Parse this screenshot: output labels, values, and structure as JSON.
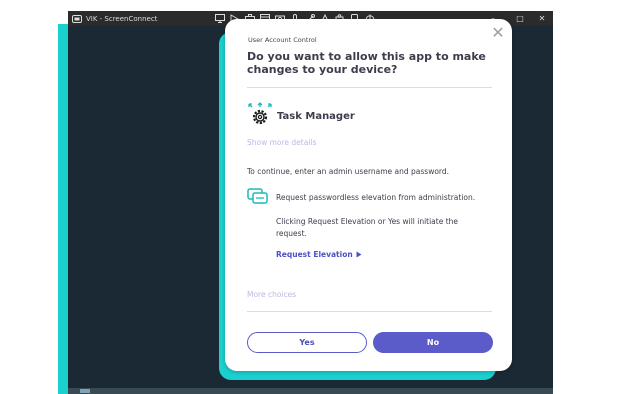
{
  "window": {
    "title": "VIK - ScreenConnect",
    "toolbar_icons": [
      "monitor-icon",
      "pointer-icon",
      "briefcase-icon",
      "grid-icon",
      "camera-icon",
      "mic-icon",
      "tools-icon",
      "flag-icon",
      "puzzle-icon",
      "phone-icon",
      "power-icon"
    ],
    "minimize": "–",
    "maximize": "□",
    "close": "✕"
  },
  "dialog": {
    "header_label": "User Account Control",
    "question": "Do you want to allow this app to make changes to your device?",
    "close_glyph": "✕",
    "app_name": "Task Manager",
    "show_more_details": "Show more details",
    "continue_text": "To continue, enter an admin username and password.",
    "elevation_text": "Request passwordless elevation from administration.",
    "clicking_text": "Clicking Request Elevation or Yes will initiate the request.",
    "request_elevation_link": "Request Elevation",
    "more_choices": "More choices",
    "yes_label": "Yes",
    "no_label": "No"
  },
  "colors": {
    "accent": "#5b5cc9",
    "cyan": "#1ad1cf",
    "link_muted": "#b9b9e6",
    "window_bg": "#1b2934"
  }
}
